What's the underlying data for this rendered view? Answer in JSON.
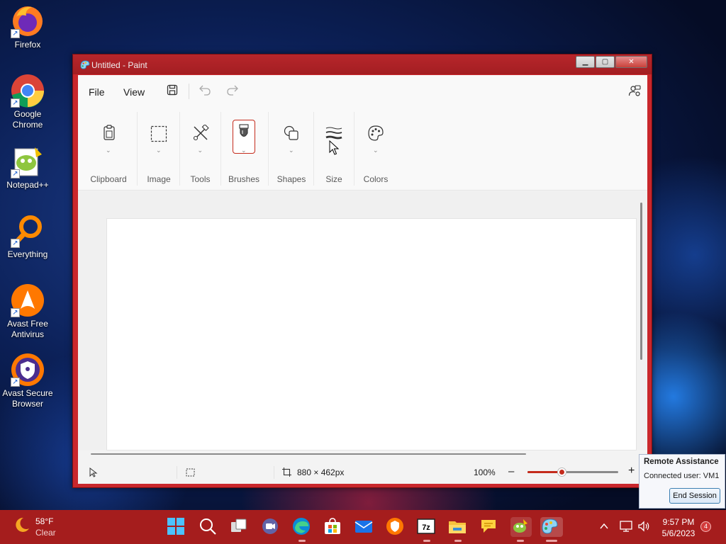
{
  "desktop": {
    "icons": [
      {
        "label": "Firefox",
        "icon": "firefox-icon"
      },
      {
        "label": "Google Chrome",
        "icon": "chrome-icon"
      },
      {
        "label": "Notepad++",
        "icon": "notepadpp-icon"
      },
      {
        "label": "Everything",
        "icon": "everything-icon"
      },
      {
        "label": "Avast Free Antivirus",
        "icon": "avast-icon"
      },
      {
        "label": "Avast Secure Browser",
        "icon": "avast-browser-icon"
      }
    ]
  },
  "window": {
    "title": "Untitled - Paint",
    "controls": {
      "minimize": "minimize-icon",
      "maximize": "maximize-icon",
      "close": "close-icon"
    },
    "accent_color": "#c9272c"
  },
  "menubar": {
    "file": "File",
    "view": "View",
    "icons": [
      "save-icon",
      "undo-icon",
      "redo-icon",
      "settings-account-icon"
    ]
  },
  "ribbon": {
    "groups": [
      {
        "label": "Clipboard",
        "icon": "clipboard-icon"
      },
      {
        "label": "Image",
        "icon": "select-rectangle-icon"
      },
      {
        "label": "Tools",
        "icon": "tools-icon"
      },
      {
        "label": "Brushes",
        "icon": "brush-icon",
        "selected": true
      },
      {
        "label": "Shapes",
        "icon": "shapes-icon"
      },
      {
        "label": "Size",
        "icon": "size-icon"
      },
      {
        "label": "Colors",
        "icon": "palette-icon"
      }
    ]
  },
  "statusbar": {
    "canvas_size": "880 × 462px",
    "zoom": "100%",
    "zoom_minus": "–",
    "zoom_plus": "+",
    "zoom_level": 0.38
  },
  "remote_assistance": {
    "title": "Remote Assistance",
    "user": "Connected user: VM1",
    "end_session": "End Session"
  },
  "taskbar": {
    "weather": {
      "temp": "58°F",
      "condition": "Clear"
    },
    "apps": [
      "start-icon",
      "search-icon",
      "task-view-icon",
      "teams-icon",
      "edge-icon",
      "store-icon",
      "mail-icon",
      "avast-browser-icon",
      "7zip-icon",
      "file-explorer-icon",
      "chat-icon",
      "notepadpp-icon",
      "paint-icon"
    ],
    "clock": {
      "time": "9:57 PM",
      "date": "5/6/2023"
    },
    "notification_count": "4"
  }
}
